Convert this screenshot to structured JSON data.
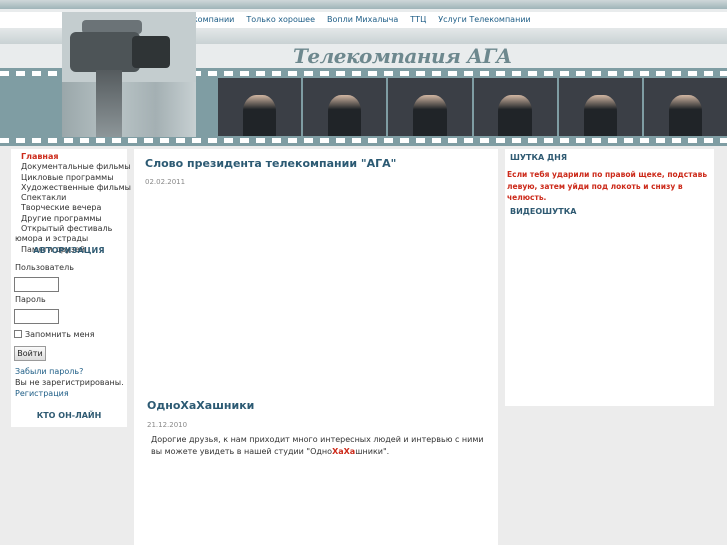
{
  "top_menu": [
    "О компании",
    "Только хорошее",
    "Вопли Михалыча",
    "ТТЦ",
    "Услуги Телекомпании"
  ],
  "logo_text": "Телекомпания АГА",
  "sidebar": {
    "items": [
      {
        "label": "Главная",
        "active": true
      },
      {
        "label": "Документальные фильмы"
      },
      {
        "label": "Цикловые программы"
      },
      {
        "label": "Художественные фильмы"
      },
      {
        "label": "Спектакли"
      },
      {
        "label": "Творческие вечера"
      },
      {
        "label": "Другие программы"
      },
      {
        "label": "Открытый фестиваль"
      },
      {
        "label": "юмора и эстрады"
      },
      {
        "label": "Памяти друзей"
      }
    ],
    "auth_title": "АВТОРИЗАЦИЯ",
    "user_label": "Пользователь",
    "password_label": "Пароль",
    "remember_label": "Запомнить меня",
    "login_button": "Войти",
    "forgot_link": "Забыли пароль?",
    "not_registered": "Вы не зарегистрированы.",
    "register_link": "Регистрация",
    "online_title": "КТО ОН-ЛАЙН"
  },
  "articles": [
    {
      "title": "Слово президента телекомпании \"АГА\"",
      "date": "02.02.2011"
    },
    {
      "title": "ОдноХаХашники",
      "date": "21.12.2010",
      "text_before": "Дорогие друзья, к нам приходит много интересных людей и интервью с ними вы можете увидеть в нашей студии \"Одно",
      "text_highlight": "ХаХа",
      "text_after": "шники\"."
    }
  ],
  "right": {
    "joke_title": "ШУТКА ДНЯ",
    "joke_text": "Если тебя ударили по правой щеке, подставь левую, затем уйди под локоть и снизу в челюсть.",
    "video_title": "ВИДЕОШУТКА"
  },
  "colors": {
    "accent_red": "#cc2a1a",
    "link_blue": "#1d5d86",
    "heading_blue": "#2c5a73",
    "film_teal": "#7f9da3"
  }
}
